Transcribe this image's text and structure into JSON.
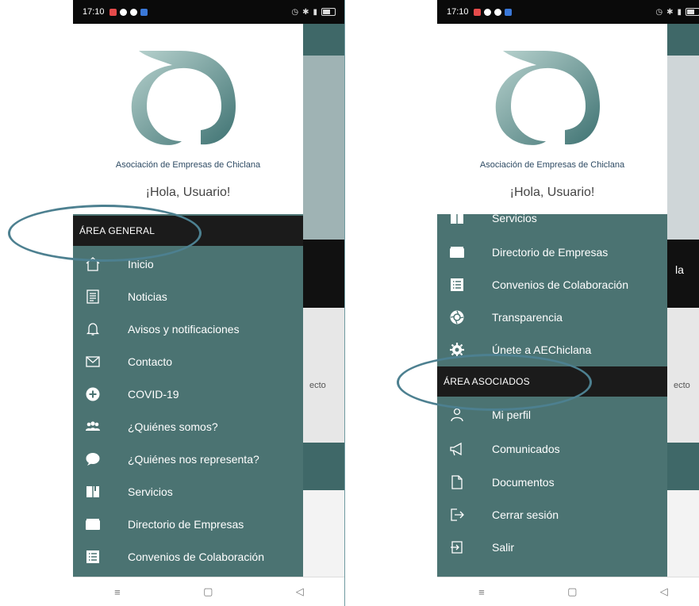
{
  "statusbar": {
    "time": "17:10"
  },
  "header": {
    "org_name": "Asociación de Empresas de Chiclana",
    "greeting": "¡Hola, Usuario!"
  },
  "left_screen": {
    "section_title": "ÁREA GENERAL",
    "items": [
      {
        "label": "Inicio",
        "icon": "home-icon"
      },
      {
        "label": "Noticias",
        "icon": "newspaper-icon"
      },
      {
        "label": "Avisos y notificaciones",
        "icon": "bell-icon"
      },
      {
        "label": "Contacto",
        "icon": "envelope-icon"
      },
      {
        "label": "COVID-19",
        "icon": "plus-circle-icon"
      },
      {
        "label": "¿Quiénes somos?",
        "icon": "group-icon"
      },
      {
        "label": "¿Quiénes nos representa?",
        "icon": "chat-icon"
      },
      {
        "label": "Servicios",
        "icon": "book-icon"
      },
      {
        "label": "Directorio de Empresas",
        "icon": "folder-icon"
      },
      {
        "label": "Convenios de Colaboración",
        "icon": "list-icon"
      }
    ]
  },
  "right_screen": {
    "items_top": [
      {
        "label": "Servicios",
        "icon": "book-icon"
      },
      {
        "label": "Directorio de Empresas",
        "icon": "folder-icon"
      },
      {
        "label": "Convenios de Colaboración",
        "icon": "list-icon"
      },
      {
        "label": "Transparencia",
        "icon": "aperture-icon"
      },
      {
        "label": "Únete a AEChiclana",
        "icon": "gear-icon"
      }
    ],
    "section_title": "ÁREA ASOCIADOS",
    "items_bottom": [
      {
        "label": "Mi perfil",
        "icon": "person-icon"
      },
      {
        "label": "Comunicados",
        "icon": "megaphone-icon"
      },
      {
        "label": "Documentos",
        "icon": "document-icon"
      },
      {
        "label": "Cerrar sesión",
        "icon": "logout-icon"
      },
      {
        "label": "Salir",
        "icon": "exit-icon"
      }
    ],
    "bg_partial_text": "la"
  },
  "bg_partial_text_left": "ecto",
  "bg_partial_text_right": "ecto",
  "colors": {
    "drawer": "#4b7372",
    "section": "#1b1b1b",
    "highlight_oval": "#4d8090"
  }
}
